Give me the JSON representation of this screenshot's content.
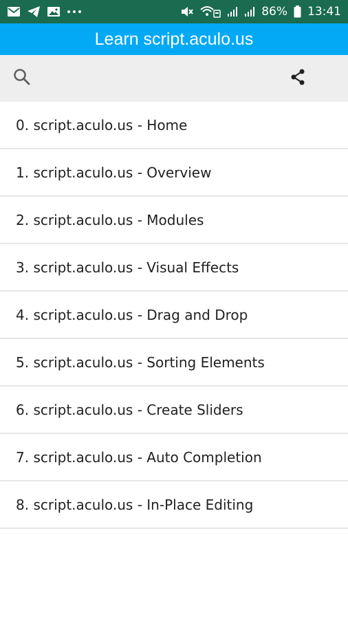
{
  "status_bar": {
    "battery": "86%",
    "time": "13:41",
    "left_icons": [
      "mail-icon",
      "telegram-icon",
      "gallery-icon",
      "more-dots-icon"
    ],
    "right_icons": [
      "mute-icon",
      "wifi-icon",
      "signal-icon",
      "signal-icon",
      "battery-icon"
    ]
  },
  "app_bar": {
    "title": "Learn script.aculo.us",
    "color": "#03a9f4"
  },
  "toolbar": {
    "icons": [
      "search-icon",
      "share-icon"
    ]
  },
  "topics": [
    {
      "label": "0. script.aculo.us - Home"
    },
    {
      "label": "1. script.aculo.us - Overview"
    },
    {
      "label": "2. script.aculo.us - Modules"
    },
    {
      "label": "3. script.aculo.us - Visual Effects"
    },
    {
      "label": "4. script.aculo.us - Drag and Drop"
    },
    {
      "label": "5. script.aculo.us - Sorting Elements"
    },
    {
      "label": "6. script.aculo.us - Create Sliders"
    },
    {
      "label": "7. script.aculo.us - Auto Completion"
    },
    {
      "label": "8. script.aculo.us - In-Place Editing"
    }
  ]
}
